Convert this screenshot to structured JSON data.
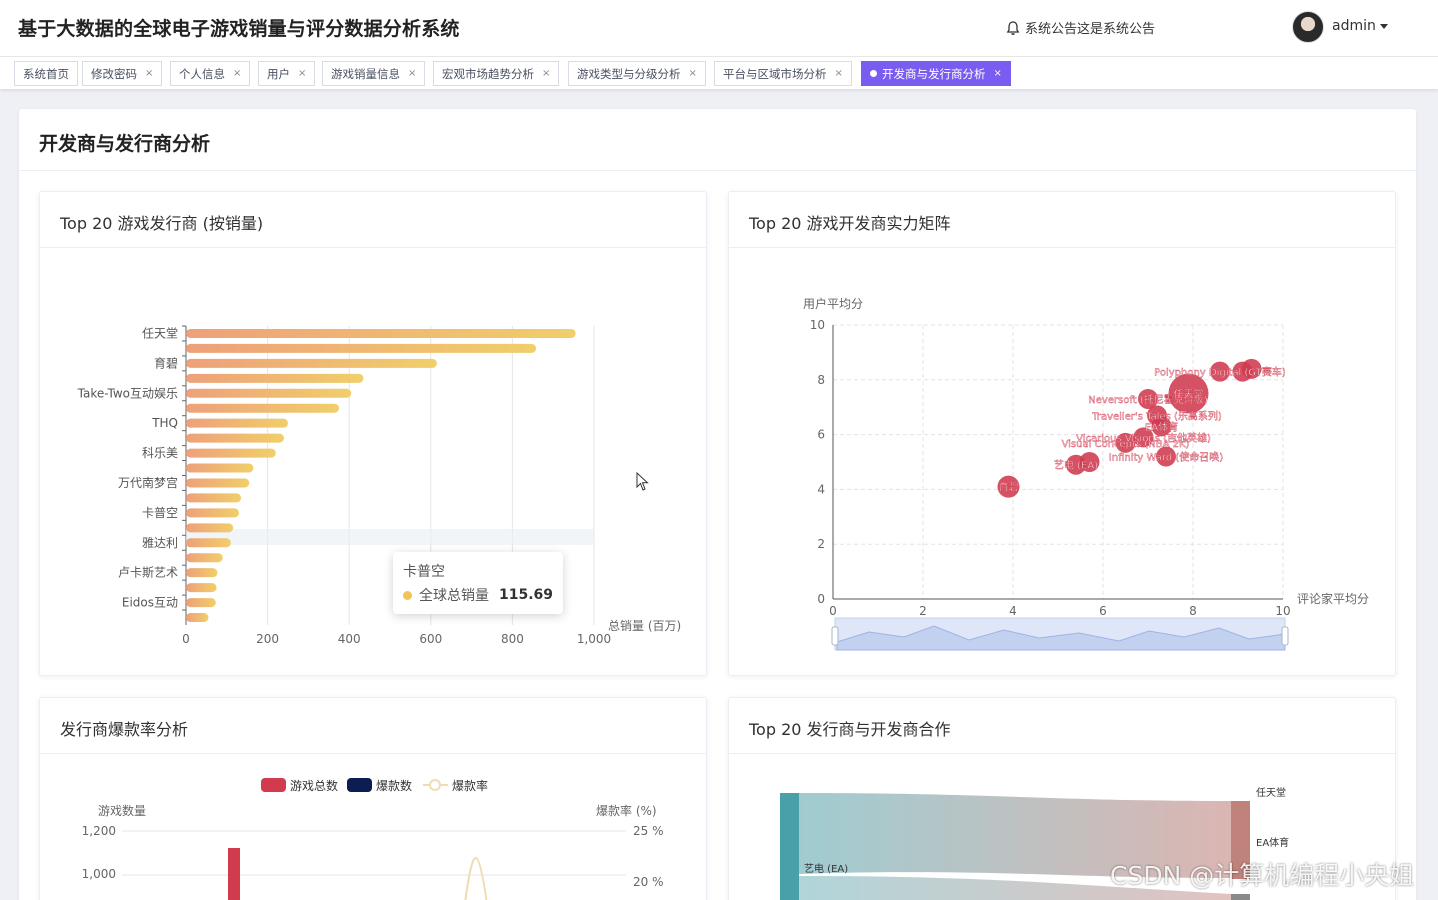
{
  "header": {
    "app_title": "基于大数据的全球电子游戏销量与评分数据分析系统",
    "notice": "系统公告这是系统公告",
    "user": "admin"
  },
  "tags": [
    {
      "label": "系统首页",
      "closable": false,
      "active": false
    },
    {
      "label": "修改密码",
      "closable": true,
      "active": false
    },
    {
      "label": "个人信息",
      "closable": true,
      "active": false
    },
    {
      "label": "用户",
      "closable": true,
      "active": false
    },
    {
      "label": "游戏销量信息",
      "closable": true,
      "active": false
    },
    {
      "label": "宏观市场趋势分析",
      "closable": true,
      "active": false
    },
    {
      "label": "游戏类型与分级分析",
      "closable": true,
      "active": false
    },
    {
      "label": "平台与区域市场分析",
      "closable": true,
      "active": false
    },
    {
      "label": "开发商与发行商分析",
      "closable": true,
      "active": true
    }
  ],
  "page": {
    "title": "开发商与发行商分析"
  },
  "panels": {
    "publishers": "Top 20 游戏发行商 (按销量)",
    "developers": "Top 20 游戏开发商实力矩阵",
    "hit_rate": "发行商爆款率分析",
    "cooperation": "Top 20 发行商与开发商合作"
  },
  "tooltip": {
    "title": "卡普空",
    "series": "全球总销量",
    "value": "115.69"
  },
  "watermark": "CSDN @计算机编程小央姐",
  "colors": {
    "accent": "#7b5cf0",
    "bar_start": "#eea07a",
    "bar_end": "#f0cf6a",
    "bubble": "#cf3a4f",
    "hit_total": "#d23a4d",
    "hit_count": "#0c1d52"
  },
  "chart_data": [
    {
      "type": "bar",
      "orientation": "horizontal",
      "title": "Top 20 游戏发行商 (按销量)",
      "xlabel": "总销量 (百万)",
      "xlim": [
        0,
        1000
      ],
      "xticks": [
        "0",
        "200",
        "400",
        "600",
        "800",
        "1,000"
      ],
      "category_labels": [
        "任天堂",
        "育碧",
        "Take-Two互动娱乐",
        "THQ",
        "科乐美",
        "万代南梦宫",
        "卡普空",
        "雅达利",
        "卢卡斯艺术",
        "Eidos互动"
      ],
      "values": [
        955,
        858,
        615,
        435,
        405,
        375,
        250,
        240,
        220,
        165,
        155,
        135,
        130,
        115.69,
        110,
        90,
        77,
        75,
        73,
        55
      ],
      "highlighted_index": 13
    },
    {
      "type": "scatter",
      "title": "Top 20 游戏开发商实力矩阵",
      "xlabel": "评论家平均分",
      "ylabel": "用户平均分",
      "xlim": [
        0,
        10
      ],
      "ylim": [
        0,
        10
      ],
      "xticks": [
        "0",
        "2",
        "4",
        "6",
        "8",
        "10"
      ],
      "yticks": [
        "0",
        "2",
        "4",
        "6",
        "8",
        "10"
      ],
      "points": [
        {
          "label": "育碧",
          "x": 3.9,
          "y": 4.1
        },
        {
          "label": "艺电 (EA)",
          "x": 5.4,
          "y": 4.9
        },
        {
          "label": "",
          "x": 5.7,
          "y": 5.0
        },
        {
          "label": "Infinity Ward (使命召唤)",
          "x": 7.4,
          "y": 5.2
        },
        {
          "label": "Visual Concepts (NBA 2K)",
          "x": 6.5,
          "y": 5.7
        },
        {
          "label": "Vicarious Visions (吉他英雄)",
          "x": 6.9,
          "y": 5.9
        },
        {
          "label": "EA体育",
          "x": 7.3,
          "y": 6.3
        },
        {
          "label": "Traveller's Tales (乐高系列)",
          "x": 7.2,
          "y": 6.7
        },
        {
          "label": "Neversoft (托尼霍克滑板)",
          "x": 7.0,
          "y": 7.3
        },
        {
          "label": "任天堂",
          "x": 7.9,
          "y": 7.5
        },
        {
          "label": "Polyphony Digital (GT赛车)",
          "x": 8.6,
          "y": 8.3
        },
        {
          "label": "",
          "x": 9.1,
          "y": 8.3
        },
        {
          "label": "",
          "x": 9.3,
          "y": 8.4
        }
      ]
    },
    {
      "type": "bar",
      "title": "发行商爆款率分析",
      "legend": [
        "游戏总数",
        "爆款数",
        "爆款率"
      ],
      "ylabel": "游戏数量",
      "y2label": "爆款率 (%)",
      "yticks": [
        "1,200",
        "1,000"
      ],
      "y2ticks": [
        "25 %",
        "20 %"
      ]
    },
    {
      "type": "sankey",
      "title": "Top 20 发行商与开发商合作",
      "nodes": [
        "艺电 (EA)",
        "任天堂",
        "EA体育"
      ]
    }
  ]
}
